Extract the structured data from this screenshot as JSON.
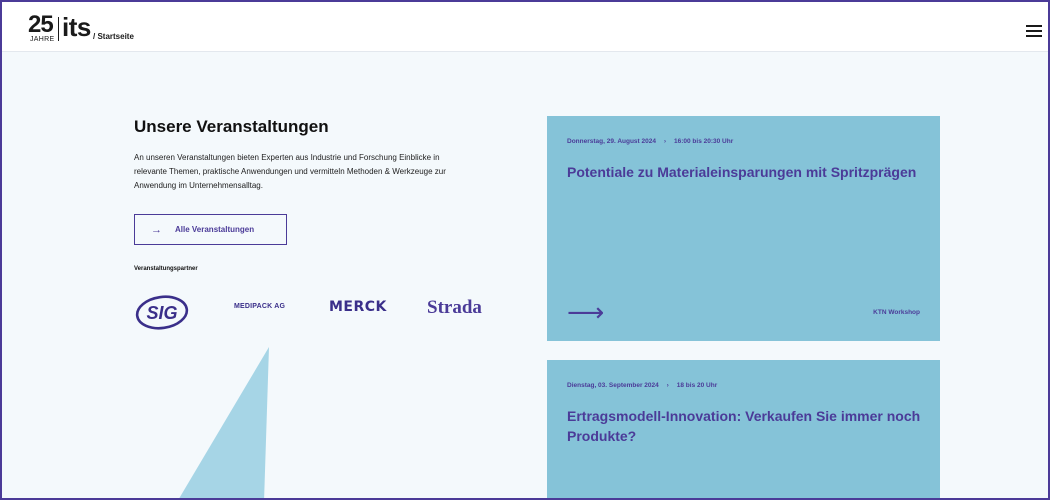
{
  "header": {
    "logo_number": "25",
    "logo_sub": "JAHRE",
    "logo_name": "its",
    "breadcrumb": "/ Startseite",
    "menu_icon": "hamburger-menu-icon"
  },
  "intro": {
    "title": "Unsere Veranstaltungen",
    "text": "An unseren Veranstaltungen bieten Experten aus Industrie und Forschung Einblicke in relevante Themen, praktische Anwendungen und vermitteln Methoden & Werkzeuge zur Anwendung im Unternehmensalltag.",
    "button_arrow": "→",
    "button_label": "Alle Veranstaltungen",
    "partners_label": "Veranstaltungspartner",
    "partners": [
      "SIG",
      "MEDIPACK AG",
      "MERCK",
      "Strada"
    ]
  },
  "events": [
    {
      "date": "Donnerstag, 29. August 2024",
      "separator": "›",
      "time": "16:00 bis 20:30 Uhr",
      "title": "Potentiale zu Materialeinsparungen mit Spritzprägen",
      "arrow": "⟶",
      "type": "KTN Workshop"
    },
    {
      "date": "Dienstag, 03. September 2024",
      "separator": "›",
      "time": "18 bis 20 Uhr",
      "title": "Ertragsmodell-Innovation: Verkaufen Sie immer noch Produkte?"
    }
  ],
  "colors": {
    "accent": "#4b3b98",
    "card_bg": "#85c3d8",
    "page_bg": "#f4f9fc",
    "shape": "#a6d5e6"
  }
}
